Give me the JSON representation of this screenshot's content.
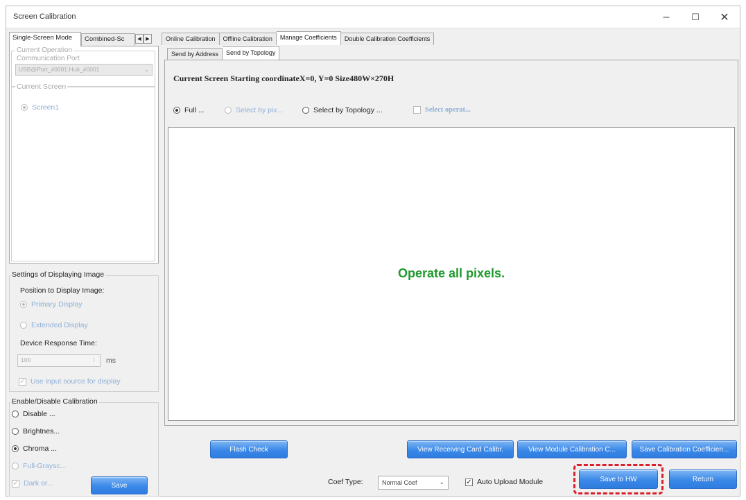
{
  "window": {
    "title": "Screen Calibration"
  },
  "left": {
    "tabs": [
      "Single-Screen Mode",
      "Combined-Sc"
    ],
    "operation_label": "Current Operation",
    "port_label": "Communication Port",
    "port_value": "USB@Port_#0001.Hub_#0001",
    "current_screen_label": "Current Screen",
    "screen_item": "Screen1",
    "display_group": "Settings of Displaying Image",
    "position_label": "Position to Display Image:",
    "primary": "Primary Display",
    "extended": "Extended Display",
    "response_label": "Device Response Time:",
    "response_value": "100",
    "response_unit": "ms",
    "use_input": "Use input source for display",
    "calib_group": "Enable/Disable Calibration",
    "opt_disable": "Disable ...",
    "opt_brightness": "Brightnes...",
    "opt_chroma": "Chroma ...",
    "opt_fullgray": "Full-Graysc...",
    "opt_dark": "Dark or...",
    "save": "Save"
  },
  "right": {
    "tabs": [
      "Online Calibration",
      "Offline Calibration",
      "Manage Coefficients",
      "Double Calibration Coefficients"
    ],
    "subtabs": [
      "Send by Address",
      "Send by Topology"
    ],
    "info": "Current Screen Starting coordinateX=0, Y=0 Size480W×270H",
    "mode_full": "Full ...",
    "mode_pixel": "Select by pix...",
    "mode_topology": "Select by Topology ...",
    "mode_operat": "Select operat...",
    "message": "Operate all pixels.",
    "flash_check": "Flash Check",
    "view_receiving": "View Receiving Card Calibr.",
    "view_module": "View Module Calibration C...",
    "save_calib": "Save Calibration Coefficien...",
    "coef_label": "Coef Type:",
    "coef_value": "Normal Coef",
    "auto_upload": "Auto Upload Module",
    "save_hw": "Save to HW",
    "return": "Return"
  }
}
